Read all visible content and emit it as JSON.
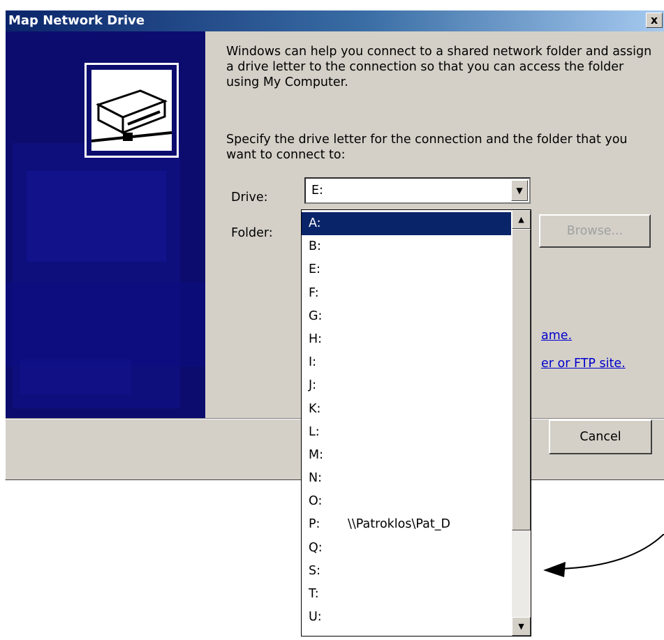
{
  "window": {
    "title": "Map Network Drive",
    "close_label": "x"
  },
  "intro_text": "Windows can help you connect to a shared network folder and assign a drive letter to the connection so that you can access the folder using My Computer.",
  "instruction_text": "Specify the drive letter for the connection and the folder that you want to connect to:",
  "drive": {
    "label": "Drive:",
    "value": "E:"
  },
  "folder": {
    "label": "Folder:"
  },
  "browse_label": "Browse...",
  "links": {
    "link1_partial": "ame.",
    "link2_partial": "er or FTP site."
  },
  "link_suffix_1": ".",
  "link_suffix_2": ".",
  "cancel_label": "Cancel",
  "dropdown_items": [
    {
      "letter": "A:",
      "path": ""
    },
    {
      "letter": "B:",
      "path": ""
    },
    {
      "letter": "E:",
      "path": ""
    },
    {
      "letter": "F:",
      "path": ""
    },
    {
      "letter": "G:",
      "path": ""
    },
    {
      "letter": "H:",
      "path": ""
    },
    {
      "letter": "I:",
      "path": ""
    },
    {
      "letter": "J:",
      "path": ""
    },
    {
      "letter": "K:",
      "path": ""
    },
    {
      "letter": "L:",
      "path": ""
    },
    {
      "letter": "M:",
      "path": ""
    },
    {
      "letter": "N:",
      "path": ""
    },
    {
      "letter": "O:",
      "path": ""
    },
    {
      "letter": "P:",
      "path": "\\\\Patroklos\\Pat_D"
    },
    {
      "letter": "Q:",
      "path": ""
    },
    {
      "letter": "S:",
      "path": ""
    },
    {
      "letter": "T:",
      "path": ""
    },
    {
      "letter": "U:",
      "path": ""
    }
  ],
  "selected_index": 0,
  "colors": {
    "panel": "#0c0c6e",
    "selection": "#0a246a",
    "link": "#0000cc"
  }
}
